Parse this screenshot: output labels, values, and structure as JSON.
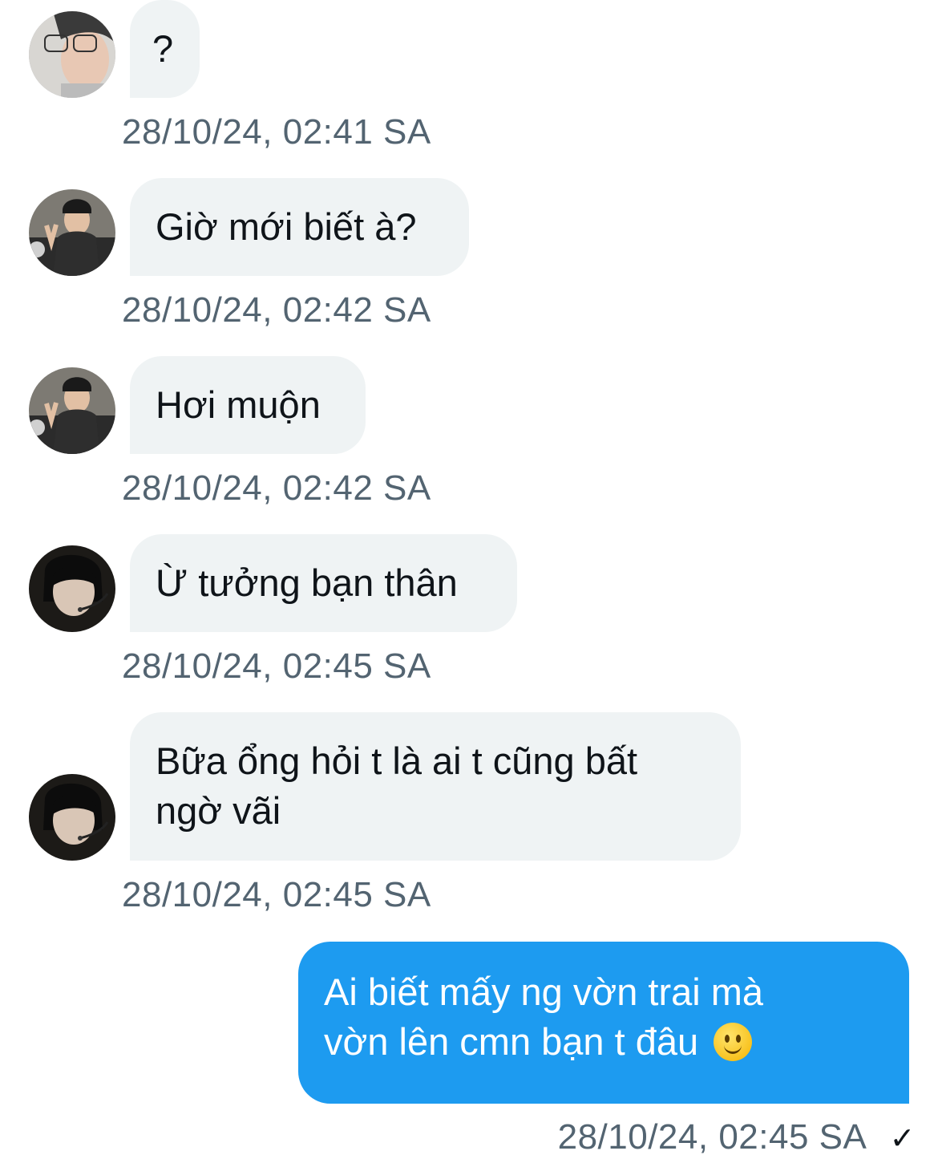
{
  "messages": [
    {
      "text": "?",
      "time": "28/10/24, 02:41 SA",
      "avatar": "avatar-1"
    },
    {
      "text": "Giờ mới biết à?",
      "time": "28/10/24, 02:42 SA",
      "avatar": "avatar-2"
    },
    {
      "text": "Hơi muộn",
      "time": "28/10/24, 02:42 SA",
      "avatar": "avatar-2"
    },
    {
      "text": "Ừ tưởng bạn thân",
      "time": "28/10/24, 02:45 SA",
      "avatar": "avatar-3"
    },
    {
      "line1": "Bữa ổng hỏi t là ai t cũng bất",
      "line2": "ngờ vãi",
      "time": "28/10/24, 02:45 SA",
      "avatar": "avatar-3"
    },
    {
      "line1": "Ai biết mấy ng vờn trai mà",
      "line2": "vờn lên cmn bạn t đâu",
      "emoji": "slightly-smiling-face-emoji",
      "time": "28/10/24, 02:45 SA",
      "status": "✓"
    }
  ],
  "colors": {
    "incoming_bubble": "#eff3f4",
    "outgoing_bubble": "#1d9bf0",
    "timestamp": "#536471"
  }
}
